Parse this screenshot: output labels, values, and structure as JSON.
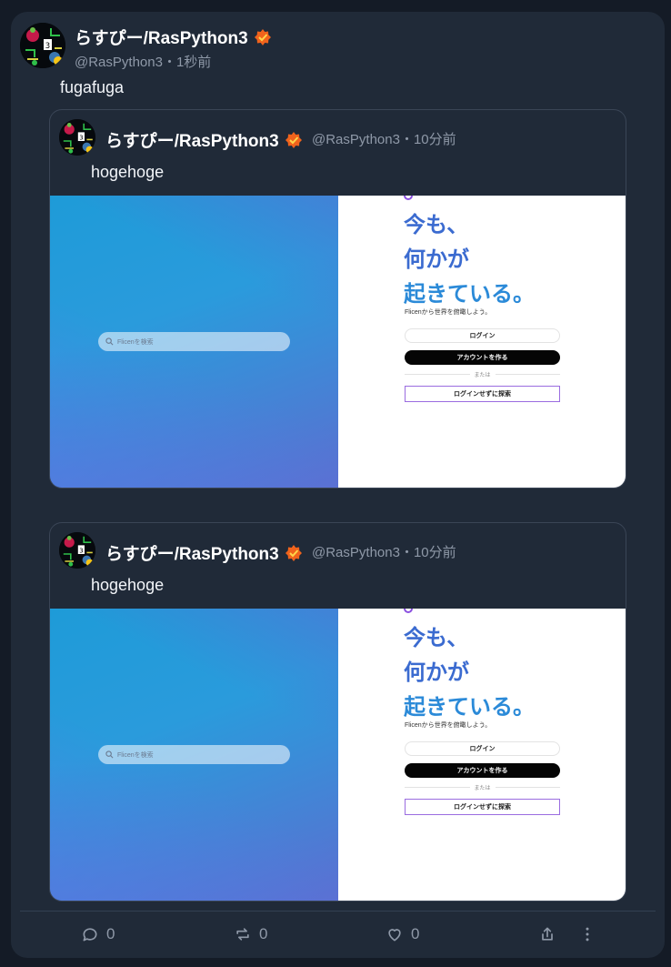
{
  "post": {
    "display_name": "らすぴー/RasPython3",
    "handle": "@RasPython3",
    "separator": "・",
    "time": "1秒前",
    "text": "fugafuga"
  },
  "quotes": [
    {
      "display_name": "らすぴー/RasPython3",
      "handle": "@RasPython3",
      "separator": "・",
      "time": "10分前",
      "text": "hogehoge",
      "screenshot": {
        "search_placeholder": "Flicenを検索",
        "headline": [
          "今も、",
          "何かが",
          "起きている。"
        ],
        "tagline": "Flicenから世界を俯瞰しよう。",
        "login_label": "ログイン",
        "create_account_label": "アカウントを作る",
        "or_label": "または",
        "guest_label": "ログインせずに探索"
      }
    },
    {
      "display_name": "らすぴー/RasPython3",
      "handle": "@RasPython3",
      "separator": "・",
      "time": "10分前",
      "text": "hogehoge",
      "screenshot": {
        "search_placeholder": "Flicenを検索",
        "headline": [
          "今も、",
          "何かが",
          "起きている。"
        ],
        "tagline": "Flicenから世界を俯瞰しよう。",
        "login_label": "ログイン",
        "create_account_label": "アカウントを作る",
        "or_label": "または",
        "guest_label": "ログインせずに探索"
      }
    }
  ],
  "actions": {
    "reply_icon": "reply-icon",
    "reply_count": "0",
    "renote_icon": "renote-icon",
    "renote_count": "0",
    "like_icon": "heart-icon",
    "like_count": "0",
    "share_icon": "share-icon",
    "more_icon": "more-vertical-icon"
  },
  "colors": {
    "background": "#141b26",
    "card": "#202a38",
    "muted_text": "#8f99a8",
    "headline_blue": "#3b6bd0",
    "badge_orange": "#f0631c"
  }
}
